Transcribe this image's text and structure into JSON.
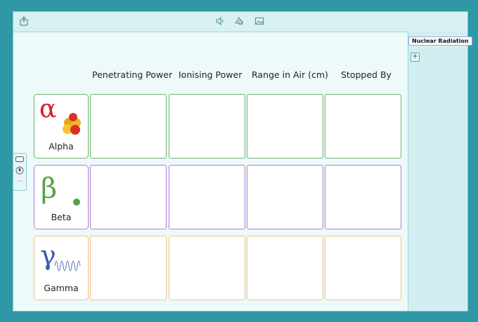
{
  "headers": [
    "Penetrating Power",
    "Ionising Power",
    "Range in Air (cm)",
    "Stopped By"
  ],
  "rows": [
    {
      "label": "Alpha",
      "symbol": "α",
      "color": "#6db36d"
    },
    {
      "label": "Beta",
      "symbol": "β",
      "color": "#b27fd1"
    },
    {
      "label": "Gamma",
      "symbol": "γ",
      "color": "#f0c48a"
    }
  ],
  "panel": {
    "tag": "Nuclear Radiation",
    "add": "+"
  },
  "side": {
    "more": "···"
  },
  "colors": {
    "alpha_symbol": "#d21f26",
    "beta_symbol": "#5aa045",
    "gamma_symbol": "#3b5aa8"
  }
}
